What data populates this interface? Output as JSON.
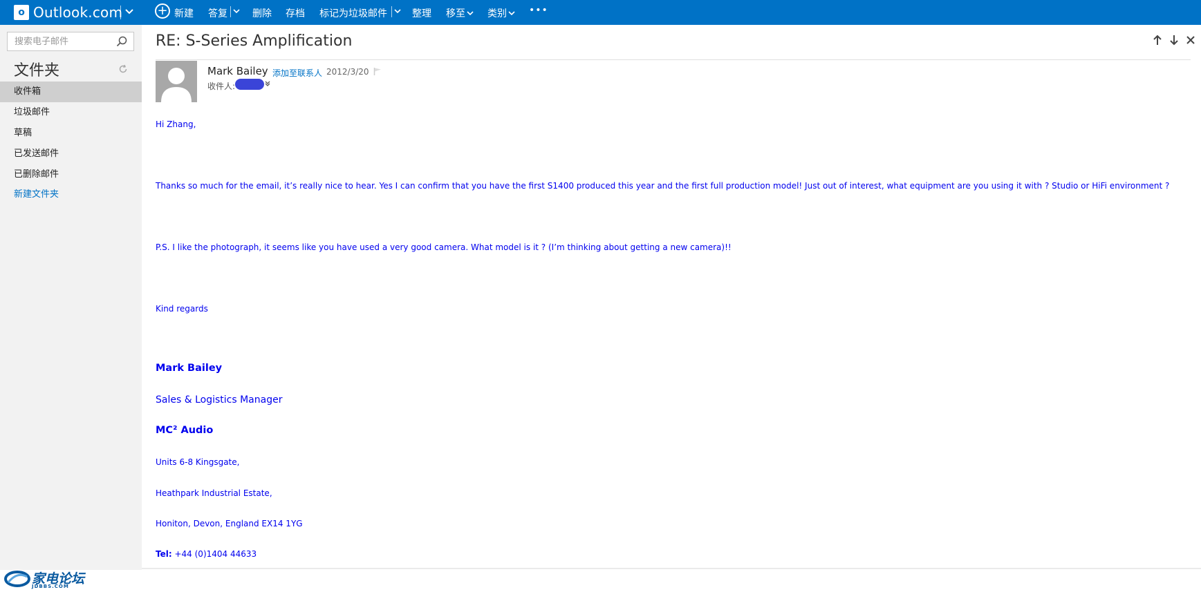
{
  "app": {
    "logo_letter": "o",
    "title": "Outlook.com"
  },
  "toolbar": {
    "new_label": "新建",
    "reply_label": "答复",
    "delete_label": "删除",
    "archive_label": "存档",
    "junk_label": "标记为垃圾邮件",
    "sweep_label": "整理",
    "move_label": "移至",
    "category_label": "类别",
    "more_label": "•••"
  },
  "sidebar": {
    "search_placeholder": "搜索电子邮件",
    "folders_title": "文件夹",
    "folders": [
      {
        "label": "收件箱"
      },
      {
        "label": "垃圾邮件"
      },
      {
        "label": "草稿"
      },
      {
        "label": "已发送邮件"
      },
      {
        "label": "已删除邮件"
      }
    ],
    "new_folder": "新建文件夹",
    "watermark": {
      "text": "家电论坛",
      "sub": "JDBBS.COM"
    }
  },
  "message": {
    "subject": "RE: S-Series Amplification",
    "sender": "Mark Bailey",
    "add_contact": "添加至联系人",
    "date": "2012/3/20",
    "to_label": "收件人:",
    "body": {
      "greeting": "Hi Zhang,",
      "p1": "Thanks so much for the email, it’s really nice to hear. Yes I can confirm that you have the first S1400 produced this year and the first full production model!  Just out of interest, what equipment are you using it with ?  Studio or HiFi environment ?",
      "p2": "P.S.  I like the photograph, it seems like you have used a very good camera.  What model is it ? (I’m thinking about getting a new camera)!!",
      "closing": "Kind regards"
    },
    "signature": {
      "name": "Mark Bailey",
      "title": "Sales & Logistics Manager",
      "company": "MC² Audio",
      "address1": "Units 6-8 Kingsgate,",
      "address2": "Heathpark Industrial Estate,",
      "address3": "Honiton, Devon,  England  EX14 1YG",
      "tel_label": "Tel:",
      "tel": "+44 (0)1404 44633"
    }
  },
  "colors": {
    "topbar": "#0072c6",
    "body_text": "#0000ee",
    "sidebar": "#f2f2f2"
  }
}
